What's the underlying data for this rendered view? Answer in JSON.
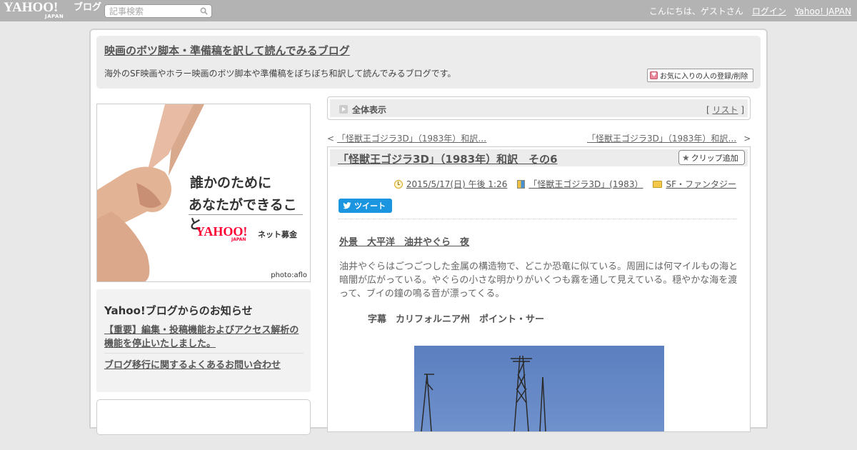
{
  "topbar": {
    "logo_yahoo": "YAHOO!",
    "logo_japan": "JAPAN",
    "logo_blog": "ブログ",
    "search_placeholder": "記事検索",
    "greeting": "こんにちは、ゲストさん",
    "login": "ログイン",
    "yahoo_japan": "Yahoo! JAPAN"
  },
  "header": {
    "title": "映画のボツ脚本・準備稿を訳して読んでみるブログ",
    "description": "海外のSF映画やホラー映画のボツ脚本や準備稿をぼちぼち和訳して読んでみるブログです。",
    "fav_button": "お気に入りの人の登録/削除"
  },
  "ad": {
    "line1": "誰かのために",
    "line2": "あなたができること",
    "brand": "YAHOO!",
    "brand_sub": "JAPAN",
    "service": "ネット募金",
    "credit": "photo:aflo"
  },
  "notice": {
    "title": "Yahoo!ブログからのお知らせ",
    "link1": "【重要】編集・投稿機能およびアクセス解析の機能を停止いたしました。",
    "link2": "ブログ移行に関するよくあるお問い合わせ"
  },
  "allview": {
    "label": "全体表示",
    "list_open": "[ ",
    "list": "リスト",
    "list_close": " ]"
  },
  "nav": {
    "prev_arrow": "<",
    "prev": "「怪獣王ゴジラ3D」（1983年）和訳…",
    "next": "「怪獣王ゴジラ3D」（1983年）和訳…",
    "next_arrow": ">"
  },
  "article": {
    "title": "「怪獣王ゴジラ3D」（1983年）和訳　その6",
    "clip_button": "クリップ追加",
    "date": "2015/5/17(日) 午後 1:26",
    "book": "「怪獣王ゴジラ3D」(1983）",
    "category": "SF・ファンタジー",
    "tweet": "ツイート",
    "scene": "外景　大平洋　油井やぐら　夜",
    "body": "油井やぐらはごつごつした金属の構造物で、どこか恐竜に似ている。周囲には何マイルもの海と暗闇が広がっている。やぐらの小さな明かりがいくつも霧を通して見えている。穏やかな海を渡って、ブイの鐘の鳴る音が漂ってくる。",
    "subtitle": "字幕　カリフォルニア州　ポイント・サー"
  },
  "icons": [
    "search-icon",
    "heart-icon",
    "arrow-icon",
    "star-icon",
    "clock-icon",
    "book-icon",
    "folder-icon",
    "bird-icon"
  ]
}
